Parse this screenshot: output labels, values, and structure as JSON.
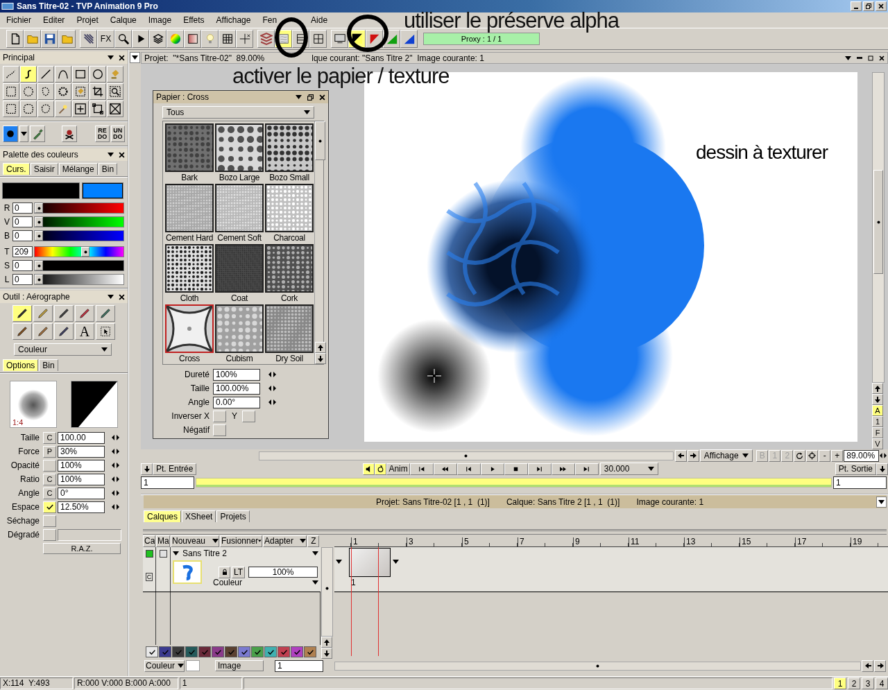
{
  "window": {
    "title": "Sans Titre-02 - TVP Animation 9 Pro"
  },
  "menu": [
    "Fichier",
    "Editer",
    "Projet",
    "Calque",
    "Image",
    "Effets",
    "Affichage",
    "Fen",
    "Aide"
  ],
  "toolbar": {
    "fx": "FX",
    "paper_on": true,
    "preserve_alpha_on": true,
    "proxy": "Proxy : 1 / 1"
  },
  "annotations": {
    "alpha_note": "utiliser le préserve alpha",
    "paper_note": "activer le papier / texture"
  },
  "project_header": {
    "left": "Projet:  \"*Sans Titre-02\"  89.00%",
    "right": "lque courant: \"Sans Titre 2\"  Image courante: 1"
  },
  "principal": {
    "title": "Principal",
    "tools": [
      {
        "selected": false
      },
      {
        "selected": true
      },
      {
        "selected": false
      },
      {
        "selected": false
      },
      {
        "selected": false
      },
      {
        "selected": false
      },
      {
        "selected": false
      },
      {
        "selected": false
      },
      {
        "selected": false
      },
      {
        "selected": false
      },
      {
        "selected": false
      },
      {
        "selected": false
      },
      {
        "selected": false
      },
      {
        "selected": false
      },
      {
        "selected": false
      },
      {
        "selected": false
      },
      {
        "selected": false
      },
      {
        "selected": false
      },
      {
        "selected": false
      },
      {
        "selected": false
      },
      {
        "selected": false
      }
    ],
    "redo": "RE DO",
    "undo": "UN DO"
  },
  "palette": {
    "title": "Palette des couleurs",
    "tabs": [
      {
        "label": "Curs.",
        "selected": true
      },
      {
        "label": "Saisir",
        "selected": false
      },
      {
        "label": "Mélange",
        "selected": false
      },
      {
        "label": "Bin",
        "selected": false
      }
    ],
    "swatches": [
      {
        "color": "#000000"
      },
      {
        "color": "#0080ff"
      }
    ],
    "channels": [
      {
        "label": "R",
        "value": "0",
        "level": 0
      },
      {
        "label": "V",
        "value": "0",
        "level": 0
      },
      {
        "label": "B",
        "value": "0",
        "level": 0
      },
      {
        "label": "T",
        "value": "209",
        "level": 0.58
      },
      {
        "label": "S",
        "value": "0",
        "level": 0
      },
      {
        "label": "L",
        "value": "0",
        "level": 0
      }
    ]
  },
  "tool_panel": {
    "title": "Outil : Aérographe",
    "tools": [
      {
        "kind": "icon",
        "selected": true
      },
      {
        "kind": "icon",
        "selected": false
      },
      {
        "kind": "icon",
        "selected": false
      },
      {
        "kind": "icon",
        "selected": false
      },
      {
        "kind": "icon",
        "selected": false
      },
      {
        "kind": "icon",
        "selected": false
      },
      {
        "kind": "icon",
        "selected": false
      },
      {
        "kind": "icon",
        "selected": false
      },
      {
        "kind": "text",
        "label": "A",
        "selected": false
      },
      {
        "kind": "icon",
        "selected": false
      }
    ],
    "mode": "Couleur",
    "tabs": [
      {
        "label": "Options",
        "selected": true
      },
      {
        "label": "Bin",
        "selected": false
      }
    ],
    "preview_ratio": "1:4",
    "params": [
      {
        "label": "Taille",
        "kind": "letter",
        "toggle": "C",
        "value": "100.00"
      },
      {
        "label": "Force",
        "kind": "letter",
        "toggle": "P",
        "value": "30%"
      },
      {
        "label": "Opacité",
        "kind": "check",
        "checked": false,
        "value": "100%"
      },
      {
        "label": "Ratio",
        "kind": "letter",
        "toggle": "C",
        "value": "100%"
      },
      {
        "label": "Angle",
        "kind": "letter",
        "toggle": "C",
        "value": "0°"
      },
      {
        "label": "Espace",
        "kind": "check",
        "checked": true,
        "value": "12.50%"
      },
      {
        "label": "Séchage",
        "kind": "check",
        "checked": false
      },
      {
        "label": "Dégradé",
        "kind": "check",
        "checked": false,
        "gradient_bar": true
      }
    ],
    "reset": "R.A.Z."
  },
  "paper": {
    "title": "Papier : Cross",
    "filter": "Tous",
    "textures": [
      {
        "name": "Bark",
        "selected": false
      },
      {
        "name": "Bozo Large",
        "selected": false
      },
      {
        "name": "Bozo Small",
        "selected": false
      },
      {
        "name": "Cement Hard",
        "selected": false
      },
      {
        "name": "Cement Soft",
        "selected": false
      },
      {
        "name": "Charcoal",
        "selected": false
      },
      {
        "name": "Cloth",
        "selected": false
      },
      {
        "name": "Coat",
        "selected": false
      },
      {
        "name": "Cork",
        "selected": false
      },
      {
        "name": "Cross",
        "selected": true
      },
      {
        "name": "Cubism",
        "selected": false
      },
      {
        "name": "Dry Soil",
        "selected": false
      }
    ],
    "params": [
      {
        "label": "Dureté",
        "value": "100%"
      },
      {
        "label": "Taille",
        "value": "100.00%"
      },
      {
        "label": "Angle",
        "value": "0.00°"
      }
    ],
    "invert_label": "Inverser X",
    "invert_y_label": "Y",
    "invert_x_checked": false,
    "invert_y_checked": false,
    "negative_label": "Négatif",
    "negative_checked": false
  },
  "canvas": {
    "caption": "dessin à texturer"
  },
  "side_buttons": [
    {
      "label": "A",
      "selected": true
    },
    {
      "label": "1",
      "selected": false
    },
    {
      "label": "F",
      "selected": false
    },
    {
      "label": "V",
      "selected": false
    }
  ],
  "view": {
    "menu": "Affichage",
    "buffers": [
      "B",
      "1",
      "2"
    ],
    "minus": "-",
    "plus": "+",
    "zoom": "89.00%"
  },
  "transport": {
    "in_point": "Pt. Entrée",
    "sound_on": true,
    "anim": "Anim",
    "fps": "30.000",
    "out_point": "Pt. Sortie",
    "start": "1",
    "end": "1"
  },
  "layers": {
    "info": [
      "Projet: Sans Titre-02 [1 , 1  (1)]",
      "Calque: Sans Titre 2 [1 , 1  (1)]",
      "Image courante: 1"
    ],
    "tabs": [
      {
        "label": "Calques",
        "selected": true
      },
      {
        "label": "XSheet",
        "selected": false
      },
      {
        "label": "Projets",
        "selected": false
      }
    ],
    "columns": [
      "Ca",
      "Ma"
    ],
    "menus": [
      "Nouveau",
      "Fusionner",
      "Adapter"
    ],
    "z": "Z",
    "ruler": [
      "1",
      "3",
      "5",
      "7",
      "9",
      "11",
      "13",
      "15",
      "17",
      "19"
    ],
    "rows": [
      {
        "name": "Sans Titre 2",
        "visible": true,
        "masked": false,
        "lt": "LT",
        "opacity": "100%",
        "mode": "Couleur",
        "marker": "C",
        "frame": "1"
      }
    ],
    "colors": [
      {
        "color": "#e8e8e8"
      },
      {
        "color": "#3b3b8f"
      },
      {
        "color": "#3c3c3c"
      },
      {
        "color": "#245a5a"
      },
      {
        "color": "#6a2a3a"
      },
      {
        "color": "#8a3a8a"
      },
      {
        "color": "#5a4030"
      },
      {
        "color": "#7a7ad0"
      },
      {
        "color": "#4aa04a"
      },
      {
        "color": "#40b0b0"
      },
      {
        "color": "#c04050"
      },
      {
        "color": "#b040c0"
      },
      {
        "color": "#b08050"
      }
    ],
    "footer": {
      "mode": "Couleur",
      "label": "Image",
      "value": "1"
    }
  },
  "status": {
    "coords": "X:114  Y:493",
    "rgba": "R:000 V:000 B:000 A:000",
    "frame": "1",
    "pages": [
      {
        "label": "1",
        "selected": true
      },
      {
        "label": "2",
        "selected": false
      },
      {
        "label": "3",
        "selected": false
      },
      {
        "label": "4",
        "selected": false
      }
    ]
  }
}
